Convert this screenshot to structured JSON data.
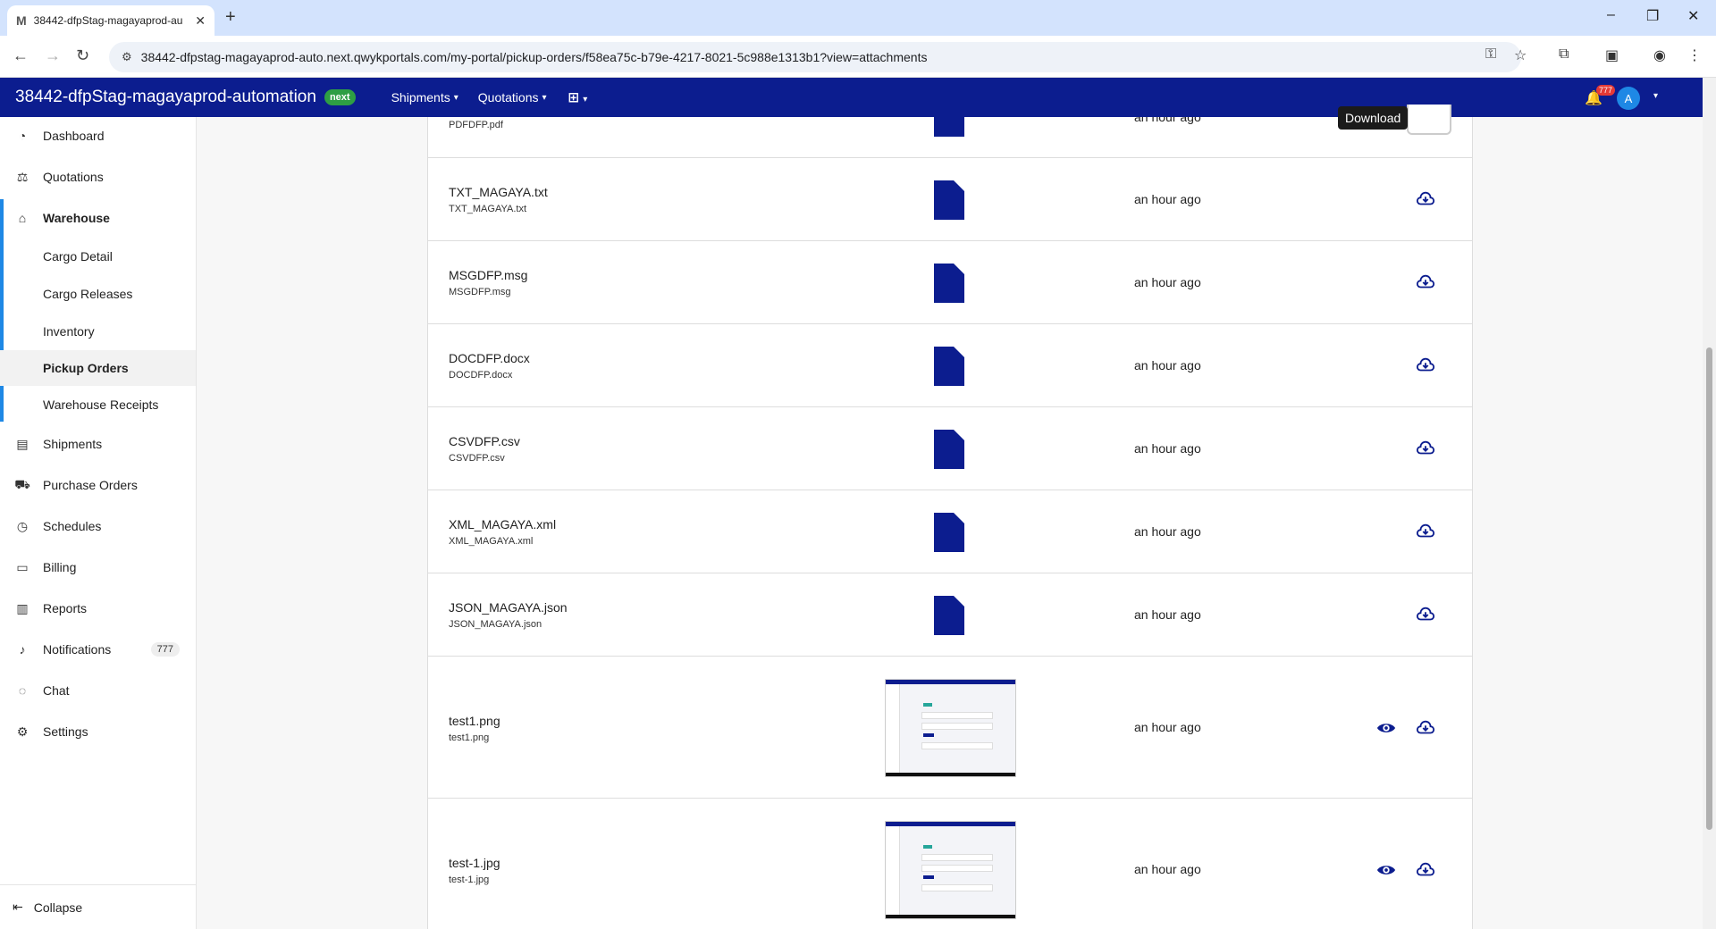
{
  "browser": {
    "tab_title": "38442-dfpStag-magayaprod-au",
    "favicon": "M",
    "url": "38442-dfpstag-magayaprod-auto.next.qwykportals.com/my-portal/pickup-orders/f58ea75c-b79e-4217-8021-5c988e1313b1?view=attachments"
  },
  "app": {
    "brand": "38442-dfpStag-magayaprod-automation",
    "badge": "next",
    "menus": [
      "Shipments",
      "Quotations"
    ],
    "notif_count": "777",
    "avatar": "A",
    "brand_color": "#0c1d8f"
  },
  "sidebar": {
    "items": [
      {
        "label": "Dashboard",
        "icon": "dashboard-icon"
      },
      {
        "label": "Quotations",
        "icon": "quotations-icon"
      },
      {
        "label": "Warehouse",
        "icon": "warehouse-icon"
      },
      {
        "label": "Shipments",
        "icon": "shipments-icon"
      },
      {
        "label": "Purchase Orders",
        "icon": "cart-icon"
      },
      {
        "label": "Schedules",
        "icon": "clock-icon"
      },
      {
        "label": "Billing",
        "icon": "billing-icon"
      },
      {
        "label": "Reports",
        "icon": "chart-icon"
      },
      {
        "label": "Notifications",
        "icon": "bell-icon"
      },
      {
        "label": "Chat",
        "icon": "chat-icon"
      },
      {
        "label": "Settings",
        "icon": "gear-icon"
      }
    ],
    "warehouse_sub": [
      "Cargo Detail",
      "Cargo Releases",
      "Inventory",
      "Pickup Orders",
      "Warehouse Receipts"
    ],
    "notif_count": "777",
    "collapse": "Collapse"
  },
  "attachments": {
    "partial_row": {
      "subname": "PDFDFP.pdf",
      "time": "an hour ago"
    },
    "rows": [
      {
        "name": "TXT_MAGAYA.txt",
        "subname": "TXT_MAGAYA.txt",
        "time": "an hour ago"
      },
      {
        "name": "MSGDFP.msg",
        "subname": "MSGDFP.msg",
        "time": "an hour ago"
      },
      {
        "name": "DOCDFP.docx",
        "subname": "DOCDFP.docx",
        "time": "an hour ago"
      },
      {
        "name": "CSVDFP.csv",
        "subname": "CSVDFP.csv",
        "time": "an hour ago"
      },
      {
        "name": "XML_MAGAYA.xml",
        "subname": "XML_MAGAYA.xml",
        "time": "an hour ago"
      },
      {
        "name": "JSON_MAGAYA.json",
        "subname": "JSON_MAGAYA.json",
        "time": "an hour ago"
      }
    ],
    "image_rows": [
      {
        "name": "test1.png",
        "subname": "test1.png",
        "time": "an hour ago"
      },
      {
        "name": "test-1.jpg",
        "subname": "test-1.jpg",
        "time": "an hour ago"
      }
    ],
    "tooltip": "Download"
  }
}
